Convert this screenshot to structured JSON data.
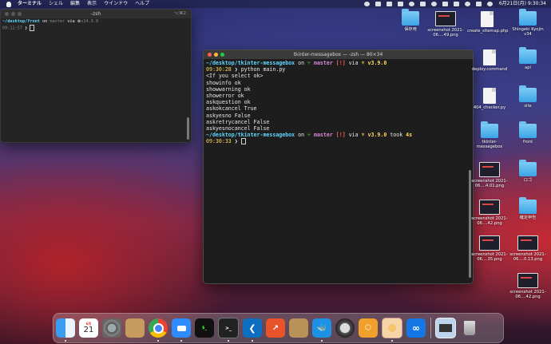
{
  "menubar": {
    "app_name": "ターミナル",
    "items": [
      "シェル",
      "編集",
      "表示",
      "ウインドウ",
      "ヘルプ"
    ],
    "clock": "6月21日(月)  9:30:34"
  },
  "window_small": {
    "title": "-zsh",
    "shortcut": "⌥⌘2",
    "line1_path": "~/desktop/front",
    "line1_on": " on ",
    "line1_branch": "master",
    "line1_via": " via ",
    "line1_node": "⬢v14.9.0",
    "line2_time": "09:12:57",
    "line2_prompt": " ❯ "
  },
  "window_main": {
    "title": "tkinter-messagebox — -zsh — 80×34",
    "prompt1": {
      "path": "~/desktop/tkinter-messagebox",
      "on": " on ",
      "branch": " master",
      "status": " [!]",
      "via": " via ",
      "python": " v3.9.0"
    },
    "cmd_time": "09:30:28",
    "cmd_sep": " ❯ ",
    "command": "python main.py",
    "output": [
      "<If you select ok>",
      "showinfo ok",
      "showwarning ok",
      "showerror ok",
      "askquestion ok",
      "askokcancel True",
      "askyesno False",
      "askretrycancel False",
      "askyesnocancel False"
    ],
    "prompt2": {
      "path": "~/desktop/tkinter-messagebox",
      "on": " on ",
      "branch": " master",
      "status": " [!]",
      "via": " via ",
      "python": " v3.9.0",
      "took": " took ",
      "duration": "4s"
    },
    "final_time": "09:30:33",
    "final_sep": " ❯ "
  },
  "desktop_icons": [
    {
      "label": "保存用",
      "kind": "folder"
    },
    {
      "label": "screenshot 2021-06....49.png",
      "kind": "screenshot"
    },
    {
      "label": "create_sitemap.php",
      "kind": "document"
    },
    {
      "label": "Shingeki Kyojin v34",
      "kind": "folder"
    },
    {
      "label": "deploy.command",
      "kind": "document"
    },
    {
      "label": "api",
      "kind": "folder"
    },
    {
      "label": "404_checker.py",
      "kind": "document"
    },
    {
      "label": "site",
      "kind": "folder"
    },
    {
      "label": "tkinter-messagebox",
      "kind": "folder"
    },
    {
      "label": "front",
      "kind": "folder"
    },
    {
      "label": "screenshot 2021-06....4.01.png",
      "kind": "screenshot"
    },
    {
      "label": "ロゴ",
      "kind": "folder"
    },
    {
      "label": "screenshot 2021-06....42.png",
      "kind": "screenshot"
    },
    {
      "label": "確定申告",
      "kind": "folder"
    },
    {
      "label": "screenshot 2021-06....35.png",
      "kind": "screenshot"
    },
    {
      "label": "screenshot 2021-06....0.13.png",
      "kind": "screenshot"
    },
    {
      "label": "screenshot 2021-06....42.png",
      "kind": "screenshot"
    }
  ],
  "dock": {
    "calendar_month": "6月",
    "calendar_day": "21",
    "apps": [
      "finder-icon",
      "calendar-icon",
      "system-preferences-icon",
      "contacts-icon",
      "chrome-icon",
      "zoom-icon",
      "activity-monitor-icon",
      "terminal-icon",
      "vscode-icon",
      "analytics-icon",
      "archive-icon",
      "docker-icon",
      "quicktime-icon",
      "sourcetree-icon",
      "preview-icon",
      "infinity-icon",
      "screenshot-thumb-icon",
      "trash-icon"
    ]
  }
}
